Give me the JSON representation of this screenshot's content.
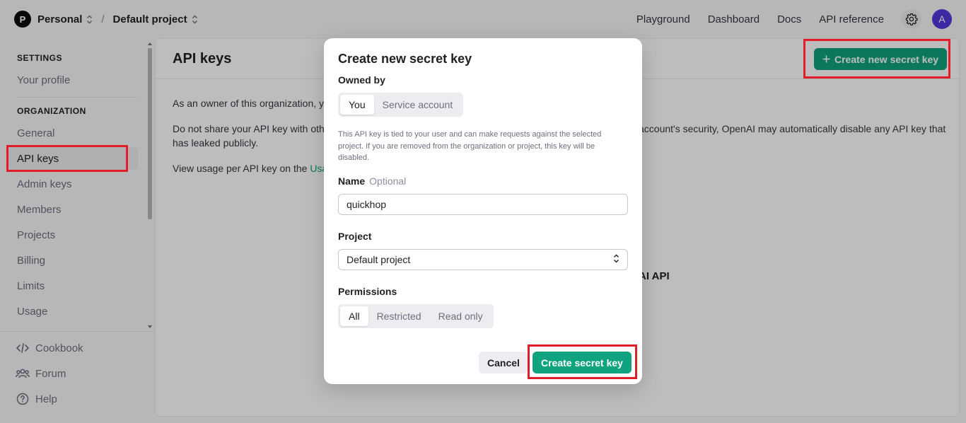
{
  "topbar": {
    "org_initial": "P",
    "org_name": "Personal",
    "separator": "/",
    "project_name": "Default project",
    "nav": [
      "Playground",
      "Dashboard",
      "Docs",
      "API reference"
    ],
    "avatar_initial": "A"
  },
  "sidebar": {
    "settings_heading": "SETTINGS",
    "profile": "Your profile",
    "org_heading": "ORGANIZATION",
    "items": [
      "General",
      "API keys",
      "Admin keys",
      "Members",
      "Projects",
      "Billing",
      "Limits",
      "Usage"
    ],
    "bottom": [
      "Cookbook",
      "Forum",
      "Help"
    ]
  },
  "main": {
    "title": "API keys",
    "create_button": "Create new secret key",
    "line1": "As an owner of this organization, yo",
    "line2a": "Do not share your API key with othe",
    "line2b": "has leaked publicly.",
    "line2_right": "account's security, OpenAI may automatically disable any API key that",
    "line3": "View usage per API key on the ",
    "line3_link": "Usag",
    "hero_fragment": "AI API"
  },
  "modal": {
    "title": "Create new secret key",
    "owned_label": "Owned by",
    "owned_options": [
      "You",
      "Service account"
    ],
    "help_text": "This API key is tied to your user and can make requests against the selected project. If you are removed from the organization or project, this key will be disabled.",
    "name_label": "Name",
    "name_optional": "Optional",
    "name_value": "quickhop",
    "project_label": "Project",
    "project_value": "Default project",
    "permissions_label": "Permissions",
    "permission_options": [
      "All",
      "Restricted",
      "Read only"
    ],
    "cancel": "Cancel",
    "submit": "Create secret key"
  },
  "colors": {
    "accent": "#10a37f",
    "highlight": "#e11d2a",
    "avatar": "#5436da"
  }
}
